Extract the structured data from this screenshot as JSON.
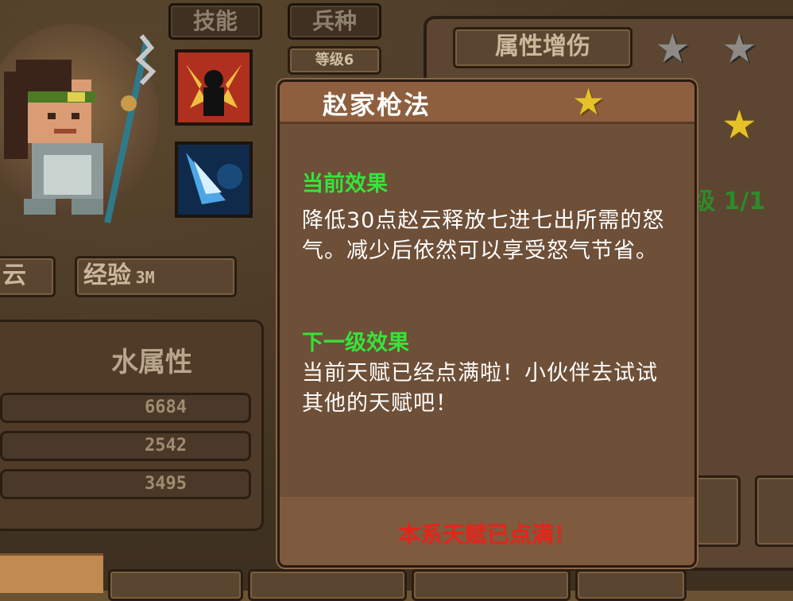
{
  "tabs": {
    "skill": "技能",
    "troop": "兵种"
  },
  "level_badge": "等级6",
  "hero_name_fragment": "云",
  "exp": {
    "label": "经验",
    "value": "3M"
  },
  "element_header": "水属性",
  "stats": [
    "6684",
    "2542",
    "3495"
  ],
  "attr_tab": "属性增伤",
  "level_progress": "级 1/1",
  "popup": {
    "title": "赵家枪法",
    "current_label": "当前效果",
    "current_text": "降低30点赵云释放七进七出所需的怒气。减少后依然可以享受怒气节省。",
    "next_label": "下一级效果",
    "next_text": "当前天赋已经点满啦！小伙伴去试试其他的天赋吧！",
    "footer": "本系天赋已点满！"
  },
  "colors": {
    "green_label": "#36e33a",
    "red_notice": "#e8231a",
    "gold_star": "#e6c22a"
  },
  "icons": [
    "star-icon",
    "silhouette-skill-icon",
    "water-skill-icon",
    "hero-portrait"
  ]
}
